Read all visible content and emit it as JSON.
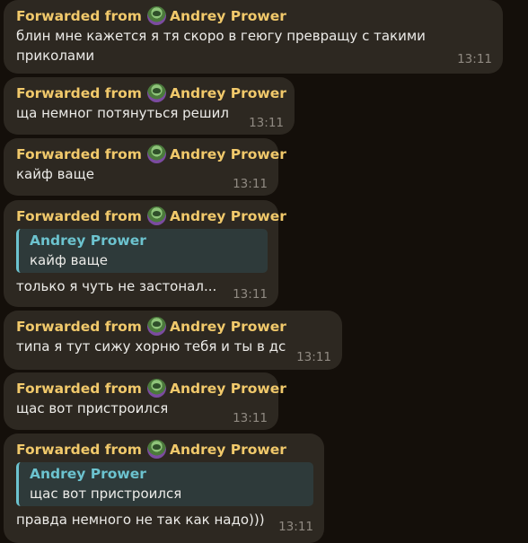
{
  "messages": [
    {
      "forward_label": "Forwarded from",
      "author": "Andrey Prower",
      "text": "блин мне кажется я тя скоро в геюгу превращу с такими приколами",
      "time": "13:11"
    },
    {
      "forward_label": "Forwarded from",
      "author": "Andrey Prower",
      "text": "ща немног потянуться решил",
      "time": "13:11"
    },
    {
      "forward_label": "Forwarded from",
      "author": "Andrey Prower",
      "text": "кайф ваще",
      "time": "13:11"
    },
    {
      "forward_label": "Forwarded from",
      "author": "Andrey Prower",
      "quote": {
        "author": "Andrey Prower",
        "text": "кайф ваще"
      },
      "text": "только я чуть не застонал...",
      "time": "13:11"
    },
    {
      "forward_label": "Forwarded from",
      "author": "Andrey Prower",
      "text": "типа я тут сижу хорню тебя и ты в дс",
      "time": "13:11"
    },
    {
      "forward_label": "Forwarded from",
      "author": "Andrey Prower",
      "text": "щас вот пристроился",
      "time": "13:11"
    },
    {
      "forward_label": "Forwarded from",
      "author": "Andrey Prower",
      "quote": {
        "author": "Andrey Prower",
        "text": "щас вот пристроился"
      },
      "text": "правда немного не так как надо)))",
      "time": "13:11"
    }
  ],
  "colors": {
    "background": "#140f0a",
    "bubble": "#2d2821",
    "forward_name": "#f1c96b",
    "quote_accent": "#6cc3cf",
    "time": "#908a82"
  },
  "icons": {
    "avatar": "avatar-icon"
  }
}
